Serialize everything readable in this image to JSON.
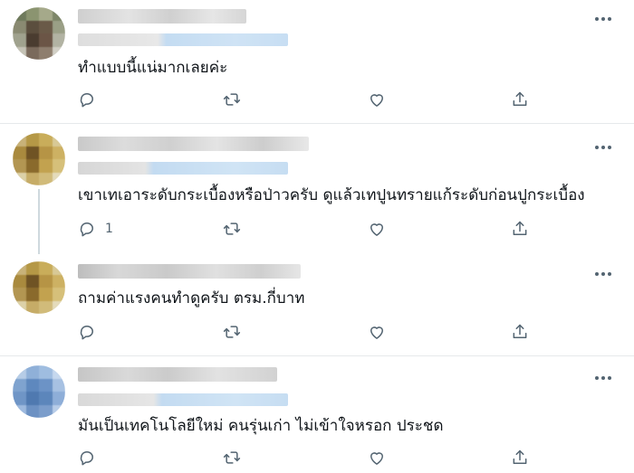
{
  "colors": {
    "text": "#0f1419",
    "muted_icon": "#536471",
    "divider": "#e6e9eb",
    "blurred_name": "#d4d4d4",
    "blurred_link": "#c8dff3"
  },
  "icons": {
    "more": "more-dots-icon",
    "reply": "reply-bubble-icon",
    "retweet": "retweet-icon",
    "like": "heart-icon",
    "share": "share-upload-icon"
  },
  "replies": [
    {
      "text": "ทำแบบนี้แน่มากเลยค่ะ",
      "reply_count": ""
    },
    {
      "text": "เขาเทเอาระดับกระเบื้องหรือป่าวครับ ดูแล้วเทปูนทรายแก้ระดับก่อนปูกระเบื้อง",
      "reply_count": "1"
    },
    {
      "text": "ถามค่าแรงคนทำดูครับ ตรม.กี่บาท",
      "reply_count": ""
    },
    {
      "text": "มันเป็นเทคโนโลยีใหม่ คนรุ่นเก่า ไม่เข้าใจหรอก  ประชด",
      "reply_count": ""
    }
  ]
}
